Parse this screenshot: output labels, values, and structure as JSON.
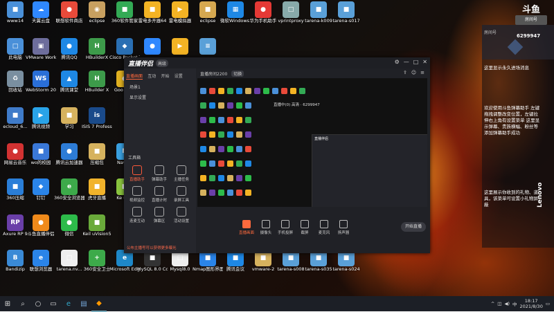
{
  "desktop_icons": [
    {
      "label": "www14",
      "color": "#4a90d9",
      "glyph": "■"
    },
    {
      "label": "天翼云盘",
      "color": "#2f88ff",
      "glyph": "☁"
    },
    {
      "label": "联想软件商店",
      "color": "#e84a3a",
      "glyph": "●"
    },
    {
      "label": "eclipse",
      "color": "#c8a060",
      "glyph": "◉"
    },
    {
      "label": "360软件管家",
      "color": "#33aa55",
      "glyph": "■"
    },
    {
      "label": "雷电多开器64",
      "color": "#f3b324",
      "glyph": "■"
    },
    {
      "label": "雷电模拟器",
      "color": "#f3b324",
      "glyph": "▶"
    },
    {
      "label": "eclipse",
      "color": "#d6a850",
      "glyph": "■"
    },
    {
      "label": "微软Windows ...",
      "color": "#1e88e5",
      "glyph": "▦"
    },
    {
      "label": "华为手机助手",
      "color": "#e53935",
      "glyph": "●"
    },
    {
      "label": "vprintproxy",
      "color": "#8aa",
      "glyph": "□"
    },
    {
      "label": "tarena-k009",
      "color": "#5aa0d8",
      "glyph": "■"
    },
    {
      "label": "tarena-s017",
      "color": "#5aa0d8",
      "glyph": "■"
    },
    {
      "label": "此电脑",
      "color": "#4a90d9",
      "glyph": "□"
    },
    {
      "label": "VMware Workstati...",
      "color": "#6d6d9c",
      "glyph": "▣"
    },
    {
      "label": "腾讯QQ",
      "color": "#1e88e5",
      "glyph": "●"
    },
    {
      "label": "HBuilderX",
      "color": "#3d9b4a",
      "glyph": "H"
    },
    {
      "label": "Cisco Packet Tracer",
      "color": "#2a6fb3",
      "glyph": "◆"
    },
    {
      "label": "",
      "color": "#2f88ff",
      "glyph": "●"
    },
    {
      "label": "",
      "color": "#f3b324",
      "glyph": "▶"
    },
    {
      "label": "",
      "color": "#5aa0d8",
      "glyph": "≡"
    },
    {
      "label": "回收站",
      "color": "#7a8fa0",
      "glyph": "♻"
    },
    {
      "label": "WebStorm 2020.2.1 x64",
      "color": "#2a6fd8",
      "glyph": "WS"
    },
    {
      "label": "腾讯课堂",
      "color": "#1e88e5",
      "glyph": "▲"
    },
    {
      "label": "HBuilder X",
      "color": "#3d9b4a",
      "glyph": "H"
    },
    {
      "label": "Goo Chro",
      "color": "#e0b020",
      "glyph": "●"
    },
    {
      "label": "ecloud_6...",
      "color": "#3f7bc9",
      "glyph": "■"
    },
    {
      "label": "腾讯视频",
      "color": "#29a3e8",
      "glyph": "▶"
    },
    {
      "label": "学习",
      "color": "#d6b25e",
      "glyph": "■"
    },
    {
      "label": "ISIS 7 Professional",
      "color": "#1a4a8a",
      "glyph": "is"
    },
    {
      "label": "网易云音乐",
      "color": "#d23232",
      "glyph": "●"
    },
    {
      "label": "wo的校园",
      "color": "#3a78d8",
      "glyph": "■"
    },
    {
      "label": "腾讯云加速器",
      "color": "#2d7cd6",
      "glyph": "●"
    },
    {
      "label": "压缩包",
      "color": "#d6b25e",
      "glyph": "■"
    },
    {
      "label": "Navica",
      "color": "#3aa0e0",
      "glyph": "N"
    },
    {
      "label": "360压缩",
      "color": "#2a7ed8",
      "glyph": "■"
    },
    {
      "label": "钉钉",
      "color": "#2a84e8",
      "glyph": "◆"
    },
    {
      "label": "360安全浏览器",
      "color": "#3daa4a",
      "glyph": "e"
    },
    {
      "label": "虎牙直播",
      "color": "#f1b32b",
      "glyph": "■"
    },
    {
      "label": "Ke uVis",
      "color": "#8ac43e",
      "glyph": "■"
    },
    {
      "label": "Axure RP 9",
      "color": "#6a3fa8",
      "glyph": "RP"
    },
    {
      "label": "斗鱼直播伴侣",
      "color": "#f08a1a",
      "glyph": "●"
    },
    {
      "label": "微信",
      "color": "#2dbb4a",
      "glyph": "●"
    },
    {
      "label": "Keil uVision5",
      "color": "#6aaa3a",
      "glyph": "■"
    },
    {
      "label": "Bandizip",
      "color": "#3a8ad6",
      "glyph": "B"
    },
    {
      "label": "联想浏览器",
      "color": "#2a84e8",
      "glyph": "e"
    },
    {
      "label": "tarena.nv...",
      "color": "#eeeeee",
      "glyph": "□"
    },
    {
      "label": "360安全卫士",
      "color": "#3daa4a",
      "glyph": "+"
    },
    {
      "label": "Microsoft Edge",
      "color": "#1e88c8",
      "glyph": "e"
    },
    {
      "label": "MySQL 8.0 Comman...",
      "color": "#333333",
      "glyph": "■"
    },
    {
      "label": "Mysql8.0",
      "color": "#eeeeee",
      "glyph": "□"
    },
    {
      "label": "Nmap图形界面",
      "color": "#2a84e8",
      "glyph": "■"
    },
    {
      "label": "腾讯会议",
      "color": "#1e88e5",
      "glyph": "■"
    },
    {
      "label": "vmware-2",
      "color": "#d6b25e",
      "glyph": "■"
    },
    {
      "label": "tarena-s008",
      "color": "#5aa0d8",
      "glyph": "■"
    },
    {
      "label": "tarena-s035",
      "color": "#5aa0d8",
      "glyph": "■"
    },
    {
      "label": "tarena-s024",
      "color": "#5aa0d8",
      "glyph": "■"
    }
  ],
  "app": {
    "logo": "直播伴侣",
    "badge": "高级",
    "tabs": [
      "直播画面",
      "互动",
      "开始",
      "设置"
    ],
    "scenes": [
      "场景1",
      "显示设置"
    ],
    "tools_label": "工具箱",
    "tools": [
      "直播助手",
      "弹幕助手",
      "主播任务",
      "视频监控",
      "直播计时",
      "录屏工具",
      "连麦互动",
      "弹幕区",
      "活动设置"
    ],
    "footer_note": "公布主播号可以获得更多曝光",
    "top_info": [
      "直播房间2200",
      "切换"
    ],
    "top_info2": "直播中(0)  高清 · 6299947",
    "bottom_controls": [
      "直播画面",
      "摄像头",
      "手机投屏",
      "截屏",
      "麦克风",
      "扬声器"
    ],
    "start_button": "开始直播"
  },
  "overlay": {
    "room_label": "房间号",
    "room_number": "6299947",
    "line1": "这里显示永久进场消息",
    "line2": "欢迎使用斗鱼弹幕助手 左键拖拽调整改变位置，左键拉伸右上角有设置菜单 这里显示弹幕、贵族横幅、粉丝等添加弹幕助手成功",
    "line3": "这里展示你收到的礼物、道具，该菜单可设置小礼物屏蔽",
    "brand": "Lenovo"
  },
  "taskbar": {
    "time": "18:17",
    "date": "2021/8/30",
    "lang": "中"
  }
}
